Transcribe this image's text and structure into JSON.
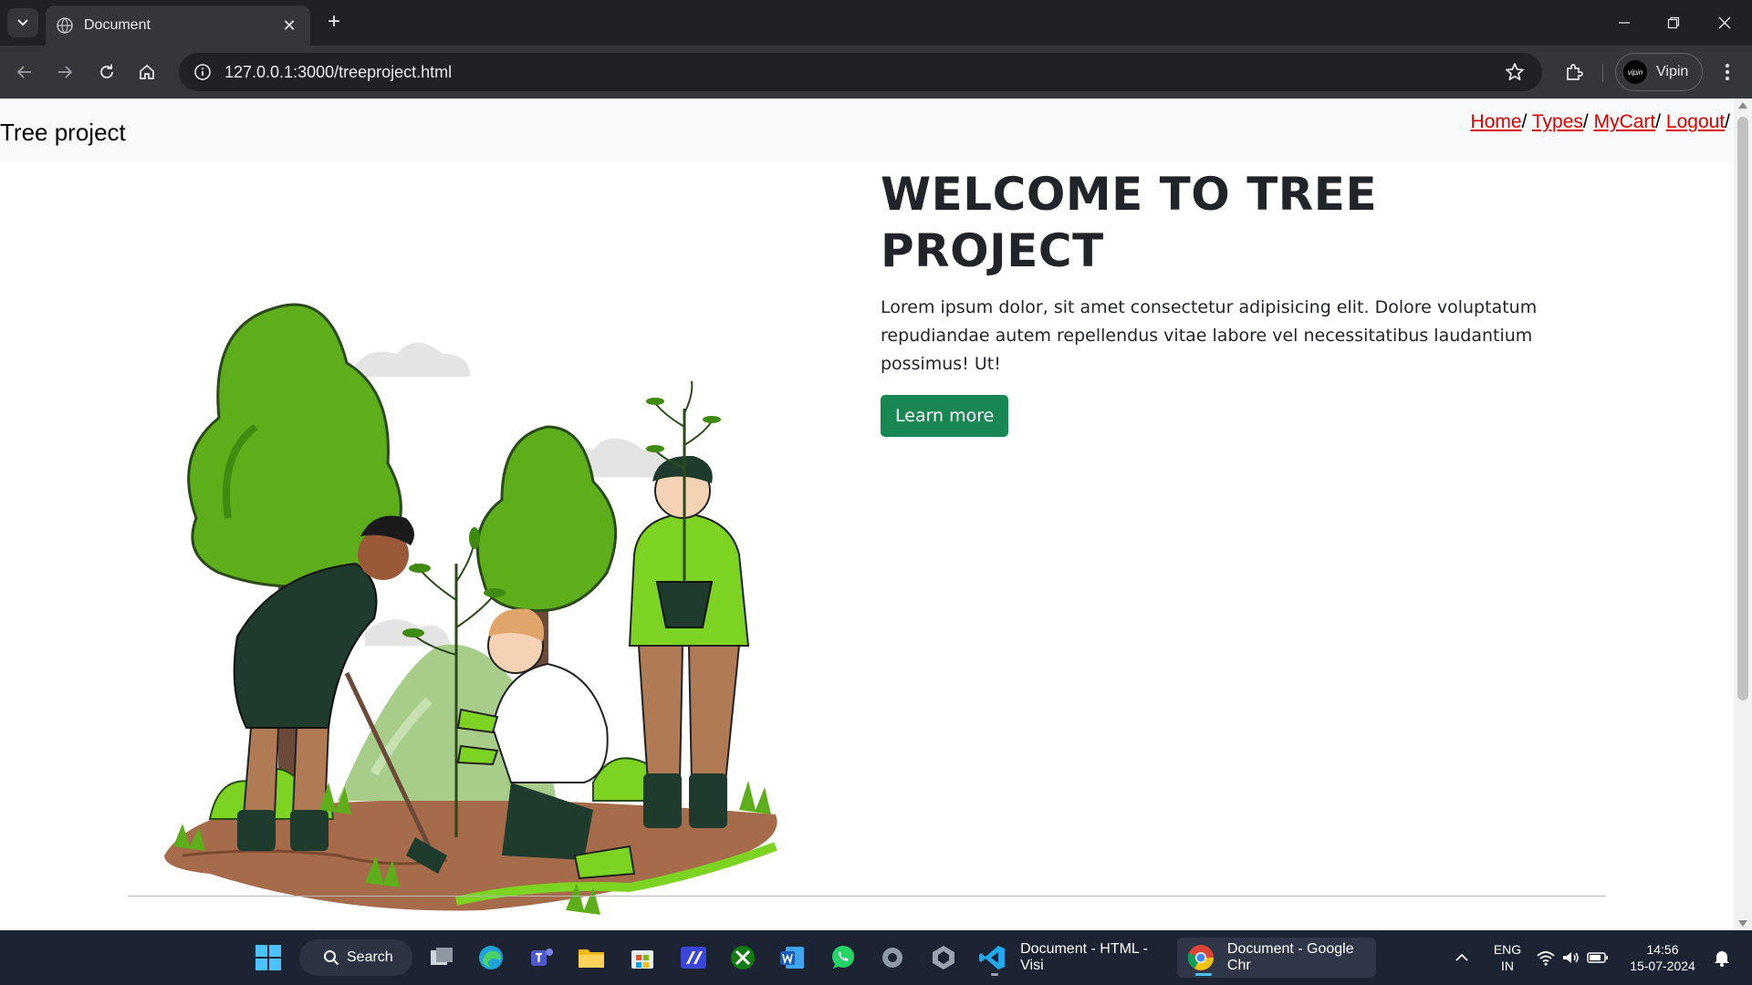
{
  "browser": {
    "tab_title": "Document",
    "url": "127.0.0.1:3000/treeproject.html",
    "profile_name": "Vipin",
    "profile_avatar_text": "vipin"
  },
  "site": {
    "brand": "Tree project",
    "nav": [
      {
        "label": "Home",
        "sep": "/ "
      },
      {
        "label": "Types",
        "sep": "/ "
      },
      {
        "label": "MyCart",
        "sep": "/ "
      },
      {
        "label": "Logout",
        "sep": "/"
      }
    ],
    "hero": {
      "heading": "WELCOME TO TREE PROJECT",
      "body": "Lorem ipsum dolor, sit amet consectetur adipisicing elit. Dolore voluptatum repudiandae autem repellendus vitae labore vel necessitatibus laudantium possimus! Ut!",
      "button_label": "Learn more"
    },
    "colors": {
      "link": "#dc0000",
      "button": "#198754",
      "nav_bg": "#f8f9fa"
    }
  },
  "taskbar": {
    "search_label": "Search",
    "apps": [
      {
        "label": "Document - HTML - Visi"
      },
      {
        "label": "Document - Google Chr"
      }
    ],
    "lang_line1": "ENG",
    "lang_line2": "IN",
    "time": "14:56",
    "date": "15-07-2024"
  }
}
